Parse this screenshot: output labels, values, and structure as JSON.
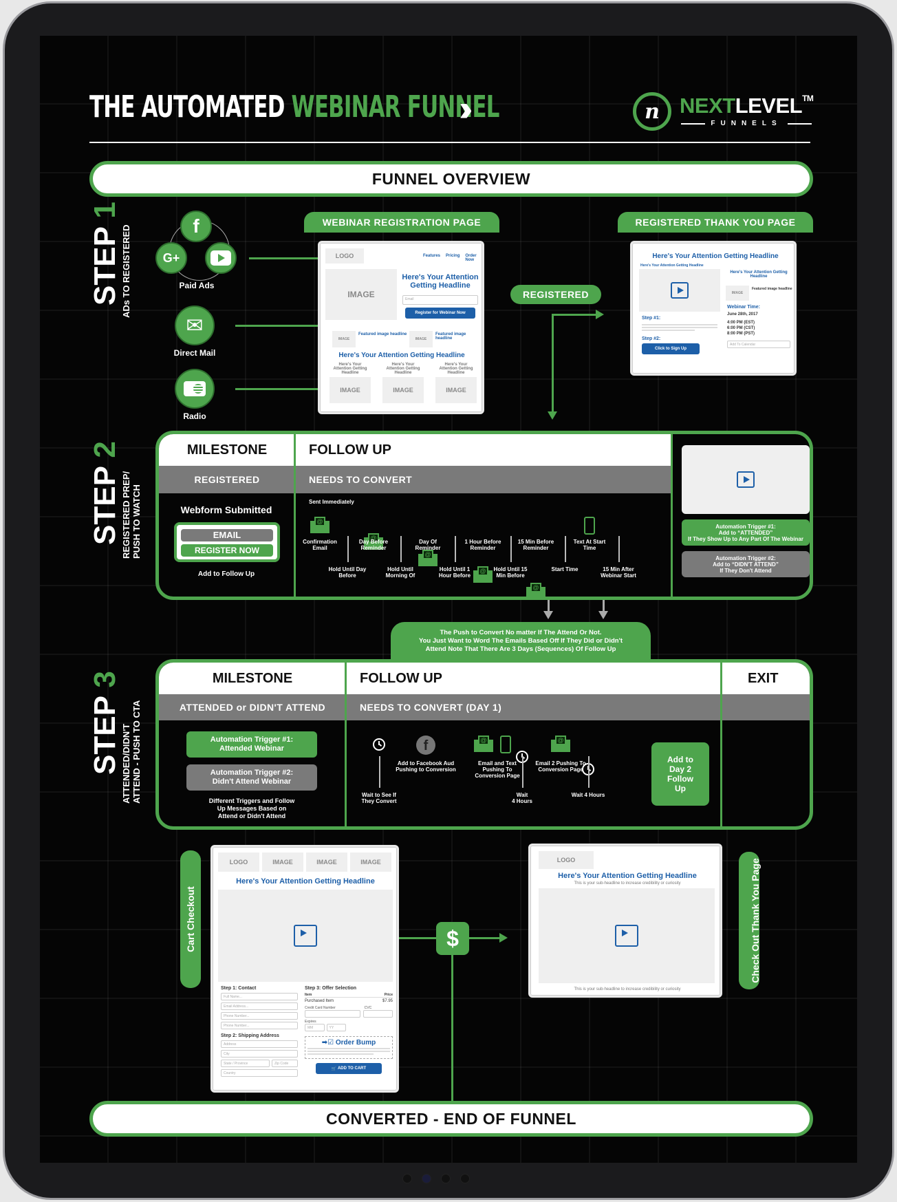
{
  "header": {
    "title_part1": "THE AUTOMATED ",
    "title_part2": "WEBINAR FUNNEL",
    "chevrons": "›››››",
    "logo_mark": "n",
    "logo_word_green": "NEXT",
    "logo_word_white": "LEVEL",
    "logo_tm": "TM",
    "logo_sub": "FUNNELS"
  },
  "overview_label": "FUNNEL OVERVIEW",
  "colors": {
    "accent": "#4ea54d",
    "grey": "#7a7a7a",
    "mockup_blue": "#1d5fa8",
    "background": "#050505"
  },
  "step1": {
    "title": "STEP",
    "number": "1",
    "subtitle": "ADs TO REGISTERED",
    "sources": [
      {
        "label": "Paid Ads",
        "icons": [
          "facebook-icon",
          "google-plus-icon",
          "youtube-icon"
        ]
      },
      {
        "label": "Direct Mail",
        "icon": "envelope-open-icon"
      },
      {
        "label": "Radio",
        "icon": "radio-icon"
      }
    ],
    "reg_page_tab": "WEBINAR REGISTRATION PAGE",
    "registered_badge": "REGISTERED",
    "thankyou_tab": "REGISTERED THANK YOU PAGE",
    "reg_page": {
      "logo": "LOGO",
      "nav": [
        "Features",
        "Pricing",
        "Order Now"
      ],
      "image": "IMAGE",
      "headline": "Here's Your Attention Getting Headline",
      "email_placeholder": "Email",
      "cta": "Register for Webinar Now",
      "featured_headline": "Featured image headline",
      "section_headline": "Here's Your Attention Getting Headline",
      "col_headline": "Here's Your Attention Getting Headline",
      "small_image": "IMAGE"
    },
    "thankyou_page": {
      "headline": "Here's Your Attention Getting Headline",
      "subheadline": "Here's Your Attention Getting Headline",
      "side_headline": "Here's Your Attention Getting Headline",
      "featured_headline": "Featured image headline",
      "image": "IMAGE",
      "webinar_time_label": "Webinar Time:",
      "date": "June 28th, 2017",
      "times": [
        "4:00 PM (EST)",
        "6:00 PM (CST)",
        "8:00 PM (PST)"
      ],
      "add_calendar": "Add To Calendar",
      "step1": "Step #1:",
      "step2": "Step #2:",
      "cta": "Click to Sign Up"
    }
  },
  "step2": {
    "title": "STEP",
    "number": "2",
    "subtitle_line1": "REGISTERED PREP/",
    "subtitle_line2": "PUSH TO WATCH",
    "milestone_header": "MILESTONE",
    "followup_header": "FOLLOW UP",
    "milestone_status": "REGISTERED",
    "followup_status": "NEEDS TO CONVERT",
    "webform_title": "Webform Submitted",
    "webform_email": "EMAIL",
    "webform_button": "REGISTER NOW",
    "webform_caption": "Add to Follow Up",
    "sent_immediately": "Sent Immediately",
    "timeline_top": [
      {
        "type": "email",
        "label": "Confirmation Email"
      },
      {
        "type": "email",
        "label": "Day Before Reminder"
      },
      {
        "type": "email",
        "label": "Day Of Reminder"
      },
      {
        "type": "email",
        "label": "1 Hour Before Reminder"
      },
      {
        "type": "email",
        "label": "15 Min Before Reminder"
      },
      {
        "type": "phone",
        "label": "Text At Start Time"
      }
    ],
    "timeline_bottom": [
      "Hold Until Day Before",
      "Hold Until Morning Of",
      "Hold Until 1 Hour Before",
      "Hold Until 15 Min Before",
      "Start Time",
      "15 Min After Webinar Start"
    ],
    "trigger1": "Automation Trigger #1: Add to “ATTENDED” If They Show Up to Any Part Of The Webinar",
    "trigger1_lines": [
      "Automation Trigger #1:",
      "Add to “ATTENDED”",
      "If They Show Up to Any Part Of The Webinar"
    ],
    "trigger2_lines": [
      "Automation Trigger #2:",
      "Add to “DIDN'T ATTEND”",
      "If They Don't Attend"
    ]
  },
  "note_lines": [
    "The Push to Convert No matter If The Attend Or Not.",
    "You Just Want to Word The Emails Based Off If They Did or Didn't",
    "Attend Note That There Are 3 Days (Sequences) Of Follow Up"
  ],
  "step3": {
    "title": "STEP",
    "number": "3",
    "subtitle_line1": "ATTENDED/DIDN'T",
    "subtitle_line2": "ATTEND - PUSH TO CTA",
    "milestone_header": "MILESTONE",
    "followup_header": "FOLLOW UP",
    "exit_header": "EXIT",
    "milestone_status": "ATTENDED or DIDN'T ATTEND",
    "followup_status": "NEEDS TO CONVERT (DAY 1)",
    "trigger1_lines": [
      "Automation Trigger #1:",
      "Attended Webinar"
    ],
    "trigger2_lines": [
      "Automation Trigger #2:",
      "Didn't Attend Webinar"
    ],
    "caption_lines": [
      "Different Triggers and Follow",
      "Up Messages Based on",
      "Attend or Didn't Attend"
    ],
    "timeline_top": [
      {
        "type": "facebook",
        "label_lines": [
          "Add to Facebook Aud",
          "Pushing to Conversion"
        ]
      },
      {
        "type": "email-phone",
        "label_lines": [
          "Email and Text",
          "Pushing To",
          "Conversion Page"
        ]
      },
      {
        "type": "email",
        "label_lines": [
          "Email 2 Pushing To",
          "Conversion Page"
        ]
      }
    ],
    "timeline_bottom": [
      [
        "Wait to See If",
        "They Convert"
      ],
      [
        "Wait",
        "4 Hours"
      ],
      [
        "Wait 4 Hours"
      ]
    ],
    "exit_button_lines": [
      "Add to",
      "Day 2",
      "Follow",
      "Up"
    ]
  },
  "checkout": {
    "side_label": "Cart Checkout",
    "logo": "LOGO",
    "images": [
      "IMAGE",
      "IMAGE",
      "IMAGE"
    ],
    "headline": "Here's Your Attention Getting Headline",
    "step1": "Step 1: Contact",
    "contact_fields": [
      "Full Name...",
      "Email Address...",
      "Phone Number...",
      "Phone Number..."
    ],
    "step2": "Step 2: Shipping Address",
    "shipping_fields": [
      "Address",
      "City",
      "State / Province",
      "Zip Code",
      "Country"
    ],
    "step3": "Step 3: Offer Selection",
    "item_col": "Item",
    "price_col": "Price",
    "item_name": "Purchased Item",
    "item_price": "$7.95",
    "card_label": "Credit Card Number",
    "cvc_label": "CVC",
    "expires_label": "Expires",
    "mm": "MM",
    "yy": "YY",
    "order_bump": "Order Bump",
    "add_to_cart": "ADD TO CART"
  },
  "dollar_icon": "$",
  "thankyou_final": {
    "side_label": "Check Out Thank You Page",
    "logo": "LOGO",
    "headline": "Here's Your Attention Getting Headline",
    "subheadline": "This is your sub-headline to increase credibility or curiosity",
    "footer": "This is your sub-headline to increase credibility or curiosity"
  },
  "end_label": "CONVERTED - END OF FUNNEL"
}
